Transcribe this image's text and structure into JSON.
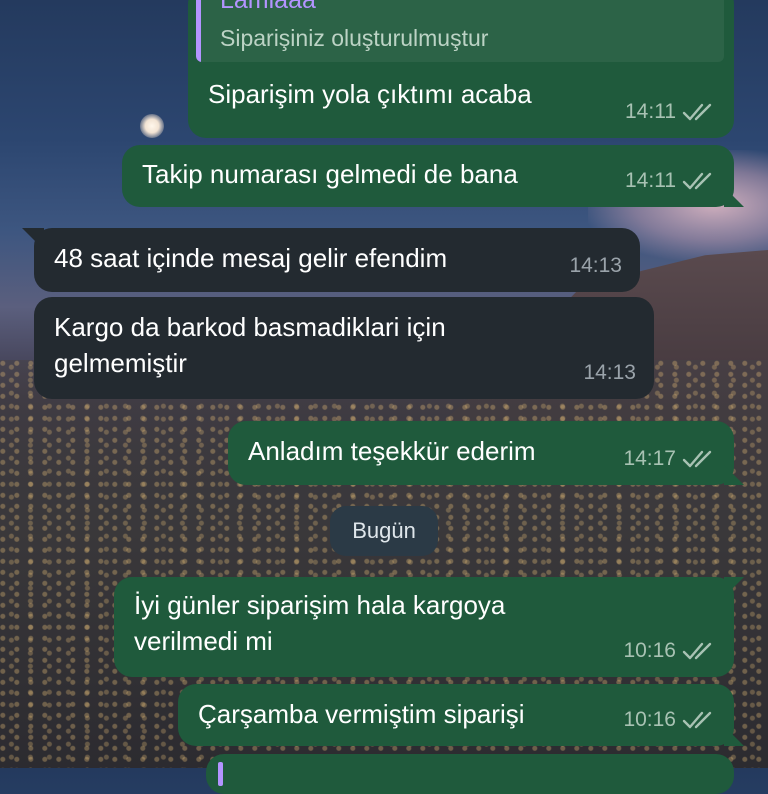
{
  "colors": {
    "outgoing_bubble": "#1f5a3c",
    "incoming_bubble": "#232a30",
    "reply_accent": "#b394ff",
    "date_chip": "#2b3a46"
  },
  "reply_quote": {
    "sender": "Lamiaaa",
    "text": "Siparişiniz oluşturulmuştur"
  },
  "messages": [
    {
      "text": "Siparişim yola çıktımı acaba",
      "time": "14:11",
      "status_icon": "double-check-icon"
    },
    {
      "text": "Takip numarası gelmedi de bana",
      "time": "14:11",
      "status_icon": "double-check-icon"
    },
    {
      "text": "48 saat içinde mesaj gelir efendim",
      "time": "14:13"
    },
    {
      "text": "Kargo da barkod basmadiklari için\ngelmemiştir",
      "time": "14:13"
    },
    {
      "text": "Anladım teşekkür ederim",
      "time": "14:17",
      "status_icon": "double-check-icon"
    },
    {
      "text": "İyi günler siparişim hala kargoya\nverilmedi mi",
      "time": "10:16",
      "status_icon": "double-check-icon"
    },
    {
      "text": "Çarşamba vermiştim siparişi",
      "time": "10:16",
      "status_icon": "double-check-icon"
    }
  ],
  "date_separator": "Bugün"
}
